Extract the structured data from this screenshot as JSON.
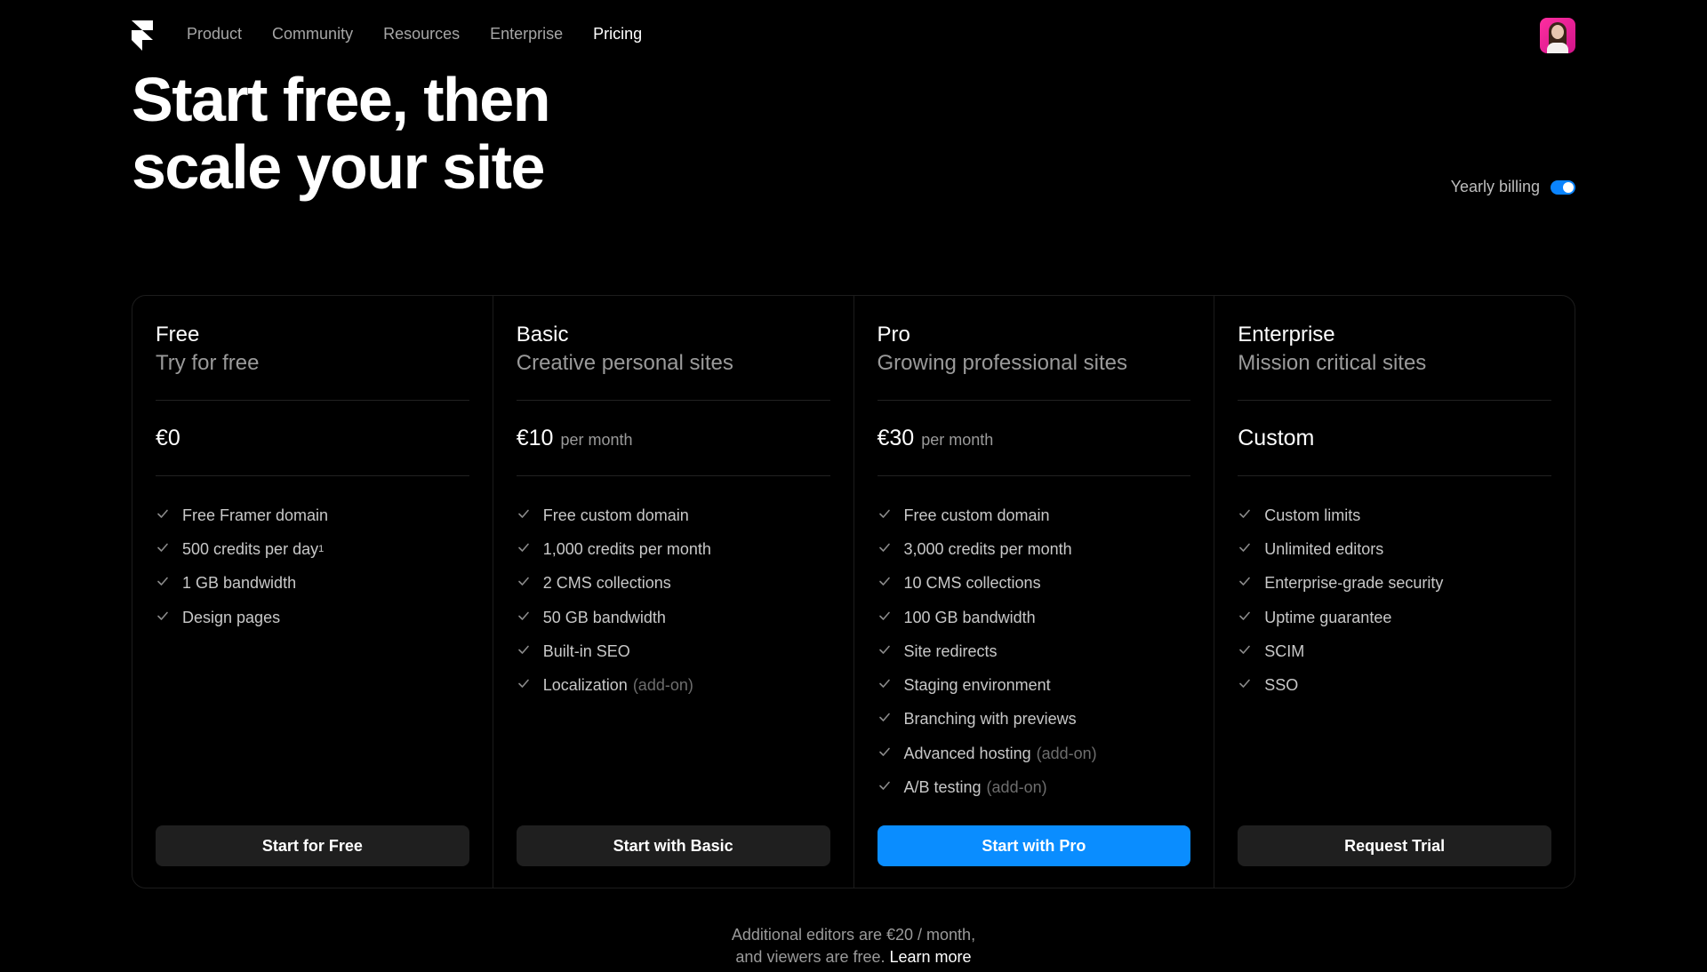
{
  "nav": {
    "links": [
      "Product",
      "Community",
      "Resources",
      "Enterprise",
      "Pricing"
    ],
    "active": "Pricing"
  },
  "hero": {
    "line1": "Start free, then",
    "line2": "scale your site"
  },
  "billing": {
    "label": "Yearly billing",
    "enabled": true,
    "accent": "#0a84ff"
  },
  "plans": [
    {
      "name": "Free",
      "desc": "Try for free",
      "price": "€0",
      "period": "",
      "features": [
        {
          "text": "Free Framer domain",
          "addon": ""
        },
        {
          "text": "500 credits per day",
          "sup": "1",
          "addon": ""
        },
        {
          "text": "1 GB bandwidth",
          "addon": ""
        },
        {
          "text": "Design pages",
          "addon": ""
        }
      ],
      "cta": "Start for Free",
      "primary": false
    },
    {
      "name": "Basic",
      "desc": "Creative personal sites",
      "price": "€10",
      "period": "per month",
      "features": [
        {
          "text": "Free custom domain",
          "addon": ""
        },
        {
          "text": "1,000 credits per month",
          "addon": ""
        },
        {
          "text": "2 CMS collections",
          "addon": ""
        },
        {
          "text": "50 GB bandwidth",
          "addon": ""
        },
        {
          "text": "Built-in SEO",
          "addon": ""
        },
        {
          "text": "Localization",
          "addon": "(add-on)"
        }
      ],
      "cta": "Start with Basic",
      "primary": false
    },
    {
      "name": "Pro",
      "desc": "Growing professional sites",
      "price": "€30",
      "period": "per month",
      "features": [
        {
          "text": "Free custom domain",
          "addon": ""
        },
        {
          "text": "3,000 credits per month",
          "addon": ""
        },
        {
          "text": "10 CMS collections",
          "addon": ""
        },
        {
          "text": "100 GB bandwidth",
          "addon": ""
        },
        {
          "text": "Site redirects",
          "addon": ""
        },
        {
          "text": "Staging environment",
          "addon": ""
        },
        {
          "text": "Branching with previews",
          "addon": ""
        },
        {
          "text": "Advanced hosting",
          "addon": "(add-on)"
        },
        {
          "text": "A/B testing",
          "addon": "(add-on)"
        }
      ],
      "cta": "Start with Pro",
      "primary": true
    },
    {
      "name": "Enterprise",
      "desc": "Mission critical sites",
      "price": "Custom",
      "period": "",
      "features": [
        {
          "text": "Custom limits",
          "addon": ""
        },
        {
          "text": "Unlimited editors",
          "addon": ""
        },
        {
          "text": "Enterprise-grade security",
          "addon": ""
        },
        {
          "text": "Uptime guarantee",
          "addon": ""
        },
        {
          "text": "SCIM",
          "addon": ""
        },
        {
          "text": "SSO",
          "addon": ""
        }
      ],
      "cta": "Request Trial",
      "primary": false
    }
  ],
  "footnote": {
    "line1": "Additional editors are €20 / month,",
    "line2": "and viewers are free.",
    "link": "Learn more"
  }
}
